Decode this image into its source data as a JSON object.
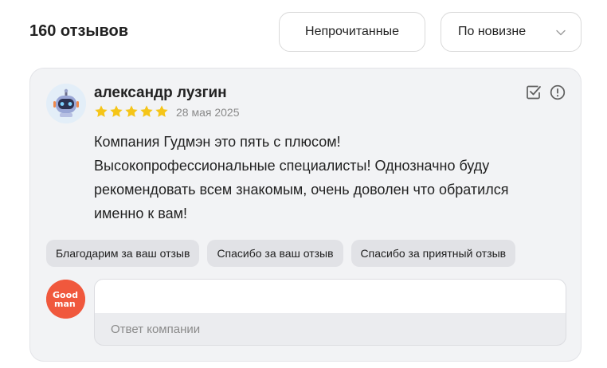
{
  "header": {
    "title": "160 отзывов",
    "filter_unread_label": "Непрочитанные",
    "sort_label": "По новизне"
  },
  "review": {
    "author": "александр лузгин",
    "rating": 5,
    "rating_max": 5,
    "date": "28 мая 2025",
    "text_lines": [
      "Компания Гудмэн это пять с плюсом!",
      "Высокопрофессиональные специалисты! Однозначно буду",
      "рекомендовать всем знакомым, очень доволен что обратился",
      "именно к вам!"
    ],
    "quick_replies": [
      "Благодарим за ваш отзыв",
      "Спасибо за ваш отзыв",
      "Спасибо за приятный отзыв"
    ],
    "reply": {
      "value": "",
      "footer_label": "Ответ компании",
      "company_logo_text": [
        "Good",
        "man"
      ]
    }
  },
  "colors": {
    "star": "#f5c518",
    "company_brand": "#f0583d",
    "card_background": "#f2f3f5",
    "chip_background": "#e1e2e6"
  },
  "icons": {
    "sort": "chevron-down-icon",
    "mark_read": "checkbox-check-icon",
    "report": "info-circle-icon",
    "star": "star-icon"
  }
}
